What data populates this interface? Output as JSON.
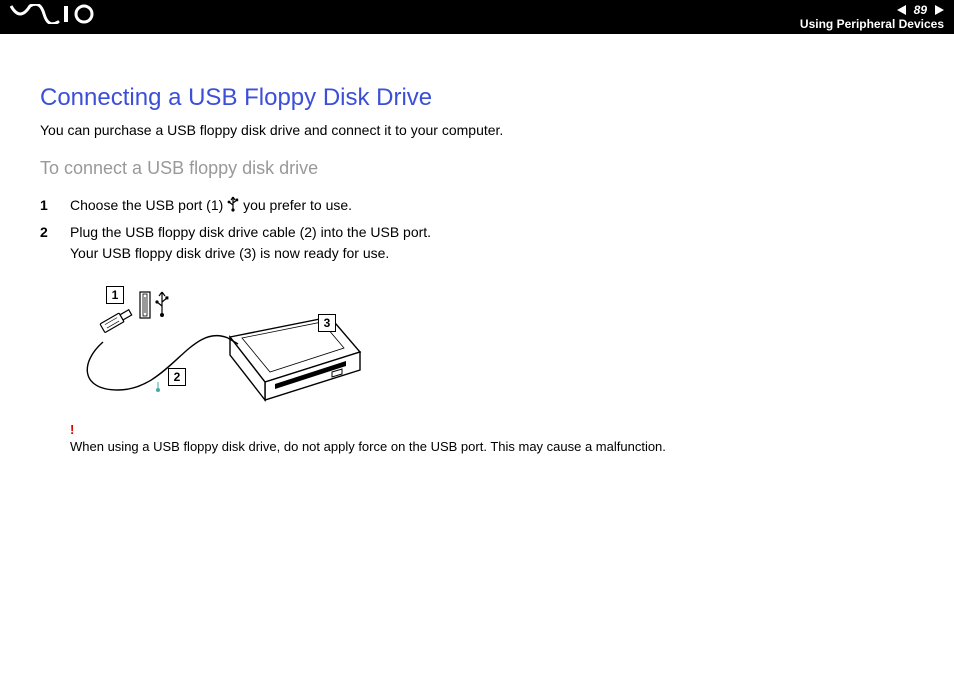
{
  "header": {
    "logo_text": "VAIO",
    "page_number": "89",
    "section": "Using Peripheral Devices"
  },
  "title": "Connecting a USB Floppy Disk Drive",
  "intro": "You can purchase a USB floppy disk drive and connect it to your computer.",
  "subheading": "To connect a USB floppy disk drive",
  "steps": [
    {
      "pre": "Choose the USB port (1) ",
      "post": " you prefer to use."
    },
    {
      "pre": "Plug the USB floppy disk drive cable (2) into the USB port.\nYour USB floppy disk drive (3) is now ready for use.",
      "post": ""
    }
  ],
  "diagram": {
    "callouts": [
      "1",
      "2",
      "3"
    ]
  },
  "warning": {
    "mark": "!",
    "text": "When using a USB floppy disk drive, do not apply force on the USB port. This may cause a malfunction."
  }
}
